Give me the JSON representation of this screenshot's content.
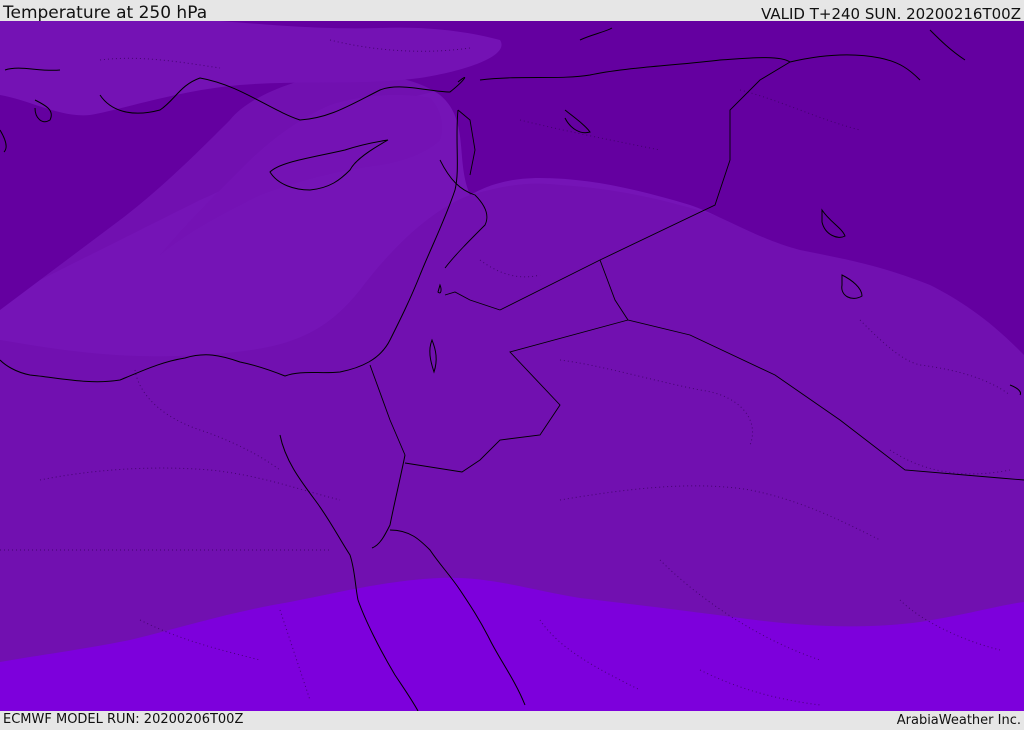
{
  "header": {
    "title": "Temperature at 250 hPa",
    "valid": "VALID T+240 SUN. 20200216T00Z"
  },
  "footer": {
    "model_run": "ECMWF MODEL RUN: 20200206T00Z",
    "credit": "ArabiaWeather Inc."
  },
  "colors": {
    "band_coldest": "#6200a0",
    "band_cold": "#7412b4",
    "band_mid": "#7010b0",
    "band_warm": "#7d00dc",
    "coastline": "#000000"
  }
}
